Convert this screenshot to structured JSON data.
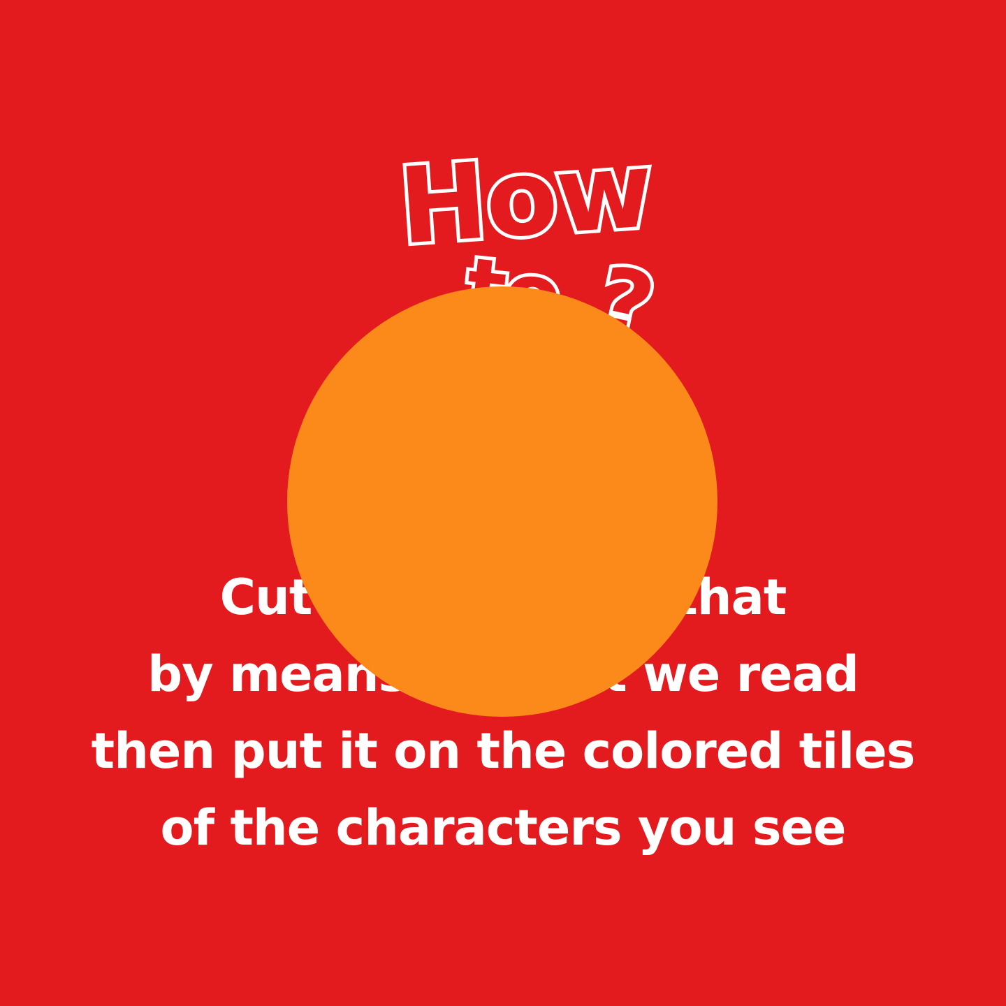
{
  "colors": {
    "background": "#e31b1f",
    "circle": "#fb8a1a",
    "text": "#ffffff"
  },
  "title": {
    "word1": "How",
    "word2": "to",
    "mark": "?"
  },
  "instructions": {
    "line1": "Cut out the card that",
    "line2": "by means of what we read",
    "line3": "then put it on the colored tiles",
    "line4": "of the characters you see"
  }
}
